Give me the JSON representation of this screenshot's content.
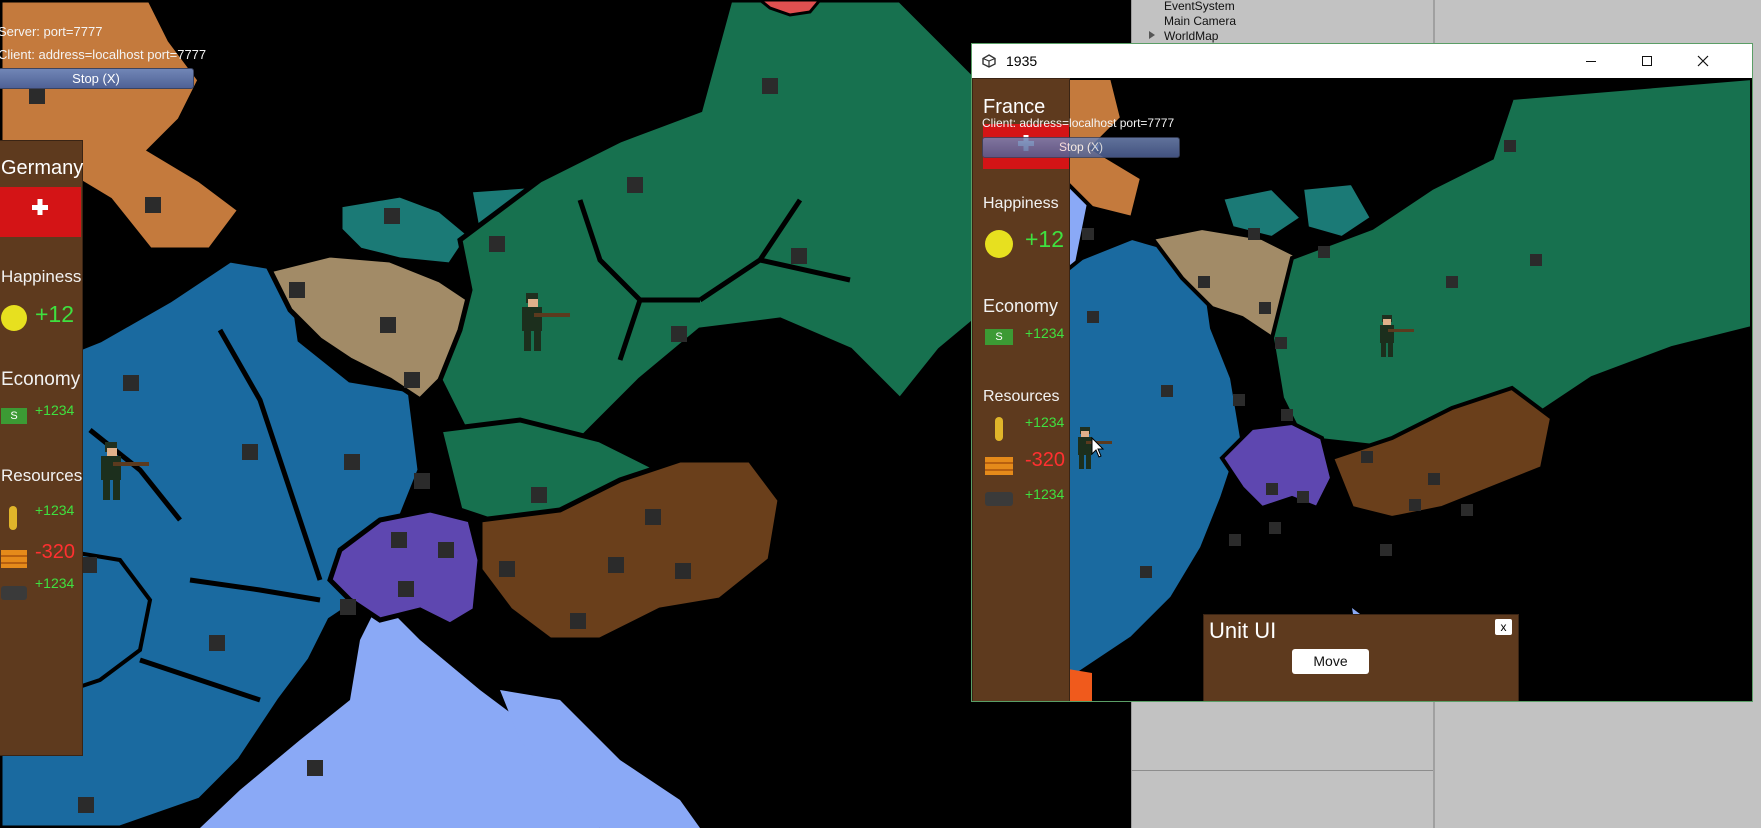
{
  "editor": {
    "hierarchy": [
      "EventSystem",
      "Main Camera",
      "WorldMap"
    ]
  },
  "main_view": {
    "server_text": "Server: port=7777",
    "client_text": "Client: address=localhost port=7777",
    "stop_label": "Stop (X)",
    "panel": {
      "country": "Germany",
      "happiness_label": "Happiness",
      "happiness_value": "+12",
      "economy_label": "Economy",
      "economy_value": "+1234",
      "resources_label": "Resources",
      "resource_1": "+1234",
      "resource_2": "-320",
      "resource_3": "+1234"
    }
  },
  "game_window": {
    "title": "1935",
    "client_text": "Client: address=localhost port=7777",
    "stop_label": "Stop (X)",
    "panel": {
      "country": "France",
      "happiness_label": "Happiness",
      "happiness_value": "+12",
      "economy_label": "Economy",
      "economy_value": "+1234",
      "resources_label": "Resources",
      "resource_1": "+1234",
      "resource_2": "-320",
      "resource_3": "+1234"
    },
    "unit_ui": {
      "title": "Unit UI",
      "close_label": "x",
      "move_label": "Move"
    }
  },
  "icons": {
    "happiness": "smiley-icon",
    "economy": "money-icon",
    "resource_1": "wheat-icon",
    "resource_2": "wood-icon",
    "resource_3": "stone-icon",
    "unity": "unity-logo-icon"
  },
  "colors": {
    "sea": "#8aa9f6",
    "land_black": "#000000",
    "region_blue": "#1a6aa0",
    "region_green": "#17714f",
    "region_teal": "#1b7a76",
    "region_tan": "#a28b67",
    "region_brown": "#6a3f1b",
    "region_orange": "#c47a3d",
    "region_purple": "#5e47b0",
    "panel_brown": "#5e3a1e",
    "positive": "#3fe03f",
    "negative": "#ff3030"
  }
}
